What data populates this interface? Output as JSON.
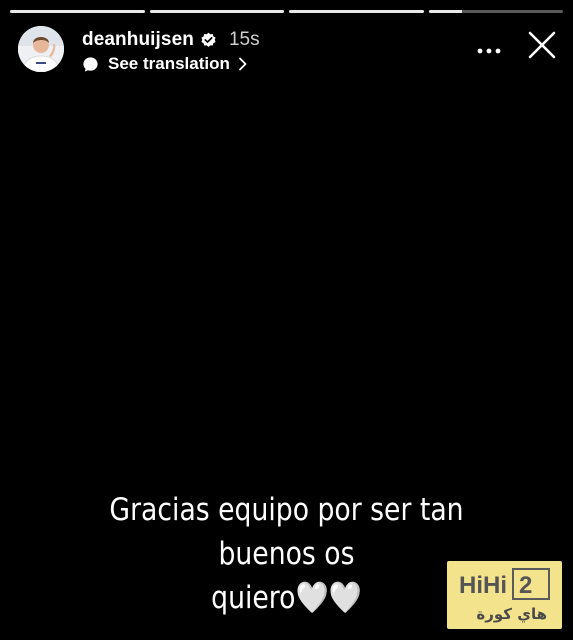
{
  "story": {
    "progress": [
      1,
      1,
      1,
      0.25
    ],
    "account": {
      "username": "deanhuijsen",
      "verified": true,
      "timestamp": "15s"
    },
    "translate_label": "See translation",
    "caption": {
      "line1": "Gracias equipo por ser tan buenos os",
      "line2": "quiero🤍🤍"
    },
    "icons": {
      "verified": "verified-badge-icon",
      "translate": "speech-bubble-icon",
      "chevron": "chevron-right-icon",
      "more": "more-dots-icon",
      "close": "close-icon"
    },
    "watermark": {
      "logo_text": "HiHi2",
      "arabic_text": "هاي كورة"
    }
  },
  "colors": {
    "background": "#000000",
    "text": "#ffffff",
    "watermark_bg": "#f3e38c"
  }
}
